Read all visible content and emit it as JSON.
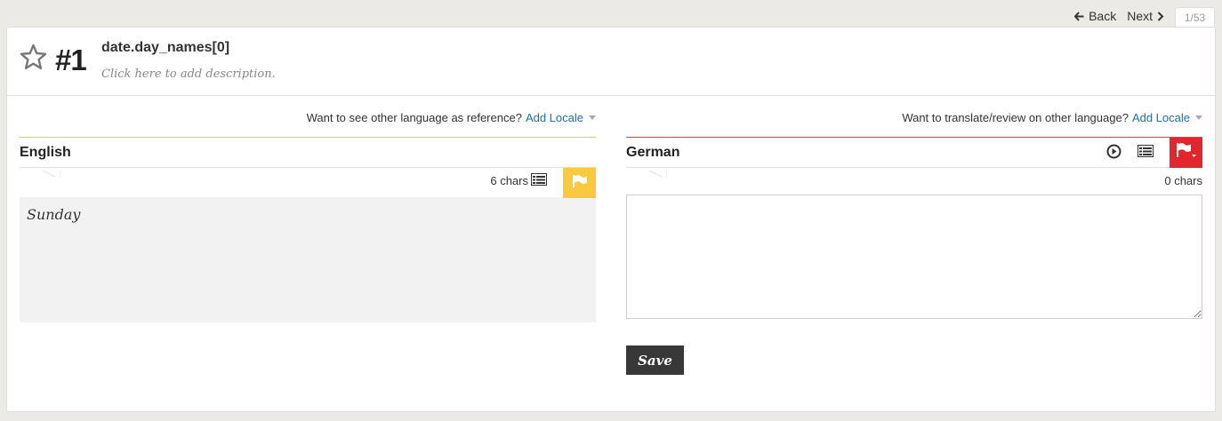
{
  "nav": {
    "back_label": "Back",
    "next_label": "Next",
    "position": "1/53"
  },
  "header": {
    "key_number": "#1",
    "key_name": "date.day_names[0]",
    "description_placeholder": "Click here to add description."
  },
  "source": {
    "reference_prompt": "Want to see other language as reference?",
    "add_locale_label": "Add Locale",
    "language": "English",
    "char_count": "6 chars",
    "text": "Sunday",
    "flag_color": "#f9c93e"
  },
  "target": {
    "translate_prompt": "Want to translate/review on other language?",
    "add_locale_label": "Add Locale",
    "language": "German",
    "char_count": "0 chars",
    "text": "",
    "flag_color": "#e1262d",
    "save_label": "Save"
  },
  "icons": [
    "back-arrow-icon",
    "next-arrow-icon",
    "star-icon",
    "caret-down-icon",
    "flag-icon",
    "list-icon",
    "play-icon"
  ]
}
